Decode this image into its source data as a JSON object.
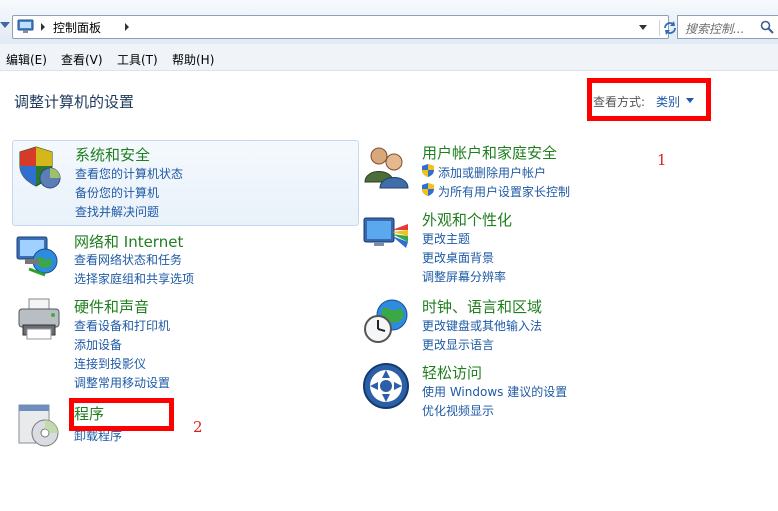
{
  "address": {
    "path": "控制面板",
    "search_placeholder": "搜索控制..."
  },
  "menu": [
    "编辑(E)",
    "查看(V)",
    "工具(T)",
    "帮助(H)"
  ],
  "page_title": "调整计算机的设置",
  "view_by": {
    "label": "查看方式:",
    "value": "类别"
  },
  "annotations": {
    "one": "1",
    "two": "2"
  },
  "categories": {
    "system": {
      "title": "系统和安全",
      "links": [
        "查看您的计算机状态",
        "备份您的计算机",
        "查找并解决问题"
      ]
    },
    "network": {
      "title": "网络和 Internet",
      "links": [
        "查看网络状态和任务",
        "选择家庭组和共享选项"
      ]
    },
    "hardware": {
      "title": "硬件和声音",
      "links": [
        "查看设备和打印机",
        "添加设备",
        "连接到投影仪",
        "调整常用移动设置"
      ]
    },
    "programs": {
      "title": "程序",
      "links": [
        "卸载程序"
      ]
    },
    "users": {
      "title": "用户帐户和家庭安全",
      "links": [
        "添加或删除用户帐户",
        "为所有用户设置家长控制"
      ]
    },
    "appearance": {
      "title": "外观和个性化",
      "links": [
        "更改主题",
        "更改桌面背景",
        "调整屏幕分辨率"
      ]
    },
    "clock": {
      "title": "时钟、语言和区域",
      "links": [
        "更改键盘或其他输入法",
        "更改显示语言"
      ]
    },
    "ease": {
      "title": "轻松访问",
      "links": [
        "使用 Windows 建议的设置",
        "优化视频显示"
      ]
    }
  }
}
